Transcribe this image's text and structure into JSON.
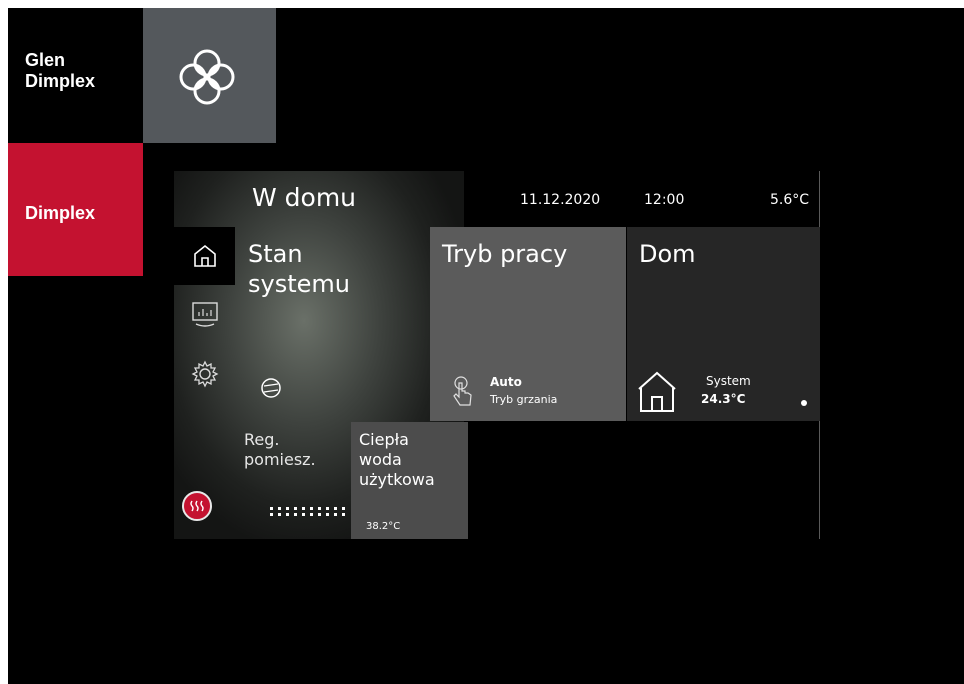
{
  "brand": {
    "glen_line1": "Glen",
    "glen_line2": "Dimplex",
    "logo_icon": "celtic-knot-icon",
    "dimplex": "Dimplex",
    "accent_color": "#c41230",
    "logo_tile_color": "#54585c"
  },
  "header": {
    "title": "W domu",
    "date": "11.12.2020",
    "time": "12:00",
    "outdoor_temp": "5.6°C"
  },
  "nav": [
    {
      "icon": "home-icon",
      "active": true
    },
    {
      "icon": "statistics-icon",
      "active": false
    },
    {
      "icon": "gear-icon",
      "active": false
    }
  ],
  "tiles": {
    "stan": {
      "title": "Stan\nsystemu",
      "icon": "compressor-icon"
    },
    "tryb": {
      "title": "Tryb pracy",
      "mode": "Auto",
      "submode": "Tryb grzania",
      "icon": "touch-hand-icon"
    },
    "dom": {
      "title": "Dom",
      "label": "System",
      "temp": "24.3°C",
      "icon": "house-icon"
    },
    "reg": {
      "title": "Reg.\npomiesz.",
      "icon": "heating-icon"
    },
    "woda": {
      "title": "Ciepła\nwoda\nużytkowa",
      "temp": "38.2°C"
    }
  }
}
